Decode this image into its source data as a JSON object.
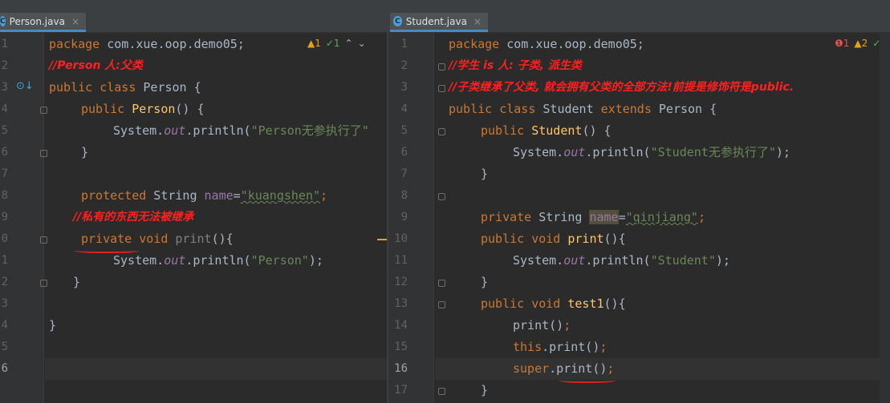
{
  "left": {
    "tab": {
      "name": "Person.java",
      "icon": "class-icon",
      "icon_glyph": "C",
      "close": "×"
    },
    "status": {
      "warnings": "▲1",
      "checks": "✓1",
      "up": "⌃",
      "down": "⌄"
    },
    "line_numbers": [
      "1",
      "2",
      "3",
      "4",
      "5",
      "6",
      "7",
      "8",
      "9",
      "0",
      "1",
      "2",
      "3",
      "4",
      "5",
      "6"
    ],
    "lines": {
      "l1_kw": "package",
      "l1_rest": " com.xue.oop.demo05;",
      "l2_cm": "//Person 人:父类",
      "l3_kw": "public class",
      "l3_rest": " Person {",
      "l4_kw": "public",
      "l4_fn": "Person",
      "l4_rest": "() {",
      "l5_a": "System.",
      "l5_st": "out",
      "l5_b": ".println(",
      "l5_str": "\"Person无参执行了\"",
      "l6": "}",
      "l8_kw": "protected",
      "l8_a": " String ",
      "l8_fld": "name",
      "l8_b": "=",
      "l8_str": "\"kuangshen\"",
      "l8_c": ";",
      "l9_cm": "//私有的东西无法被继承",
      "l10_kw": "private",
      "l10_a": " ",
      "l10_kw2": "void",
      "l10_b": " ",
      "l10_gray": "print",
      "l10_c": "(){",
      "l11_a": "System.",
      "l11_st": "out",
      "l11_b": ".println(",
      "l11_str": "\"Person\"",
      "l11_c": ");",
      "l12": "}",
      "l14": "}"
    }
  },
  "right": {
    "tab": {
      "name": "Student.java",
      "icon": "class-icon",
      "icon_glyph": "C",
      "close": "×"
    },
    "status": {
      "errors": "❶1",
      "warnings": "▲2",
      "checks": "✓"
    },
    "line_numbers": [
      "1",
      "2",
      "3",
      "4",
      "5",
      "6",
      "7",
      "8",
      "9",
      "10",
      "11",
      "12",
      "13",
      "14",
      "15",
      "16",
      "17"
    ],
    "lines": {
      "l1_kw": "package",
      "l1_rest": " com.xue.oop.demo05;",
      "l2_cm": "//学生 is 人: 子类, 派生类",
      "l3_cm": "//子类继承了父类, 就会拥有父类的全部方法!前提是修饰符是public.",
      "l4_kw": "public class",
      "l4_a": " Student ",
      "l4_kw2": "extends",
      "l4_b": " Person {",
      "l5_kw": "public",
      "l5_fn": "Student",
      "l5_rest": "() {",
      "l6_a": "System.",
      "l6_st": "out",
      "l6_b": ".println(",
      "l6_str": "\"Student无参执行了\"",
      "l6_c": ");",
      "l7": "}",
      "l9_kw": "private",
      "l9_a": " String ",
      "l9_fld": "name",
      "l9_b": "=",
      "l9_str": "\"qinjiang\"",
      "l9_c": ";",
      "l10_kw": "public void",
      "l10_fn": "print",
      "l10_rest": "(){",
      "l11_a": "System.",
      "l11_st": "out",
      "l11_b": ".println(",
      "l11_str": "\"Student\"",
      "l11_c": ");",
      "l12": "}",
      "l13_kw": "public void",
      "l13_fn": "test1",
      "l13_rest": "(){",
      "l14_a": "print()",
      "l14_b": ";",
      "l15_kw": "this",
      "l15_a": ".print()",
      "l15_b": ";",
      "l16_kw": "super",
      "l16_a": ".print()",
      "l16_b": ";",
      "l17": "}"
    }
  },
  "colors": {
    "keyword": "#cc7832",
    "string": "#6a8759",
    "method": "#ffc66d",
    "field": "#9876aa",
    "comment_red": "#ff2020",
    "background": "#2b2b2b"
  }
}
